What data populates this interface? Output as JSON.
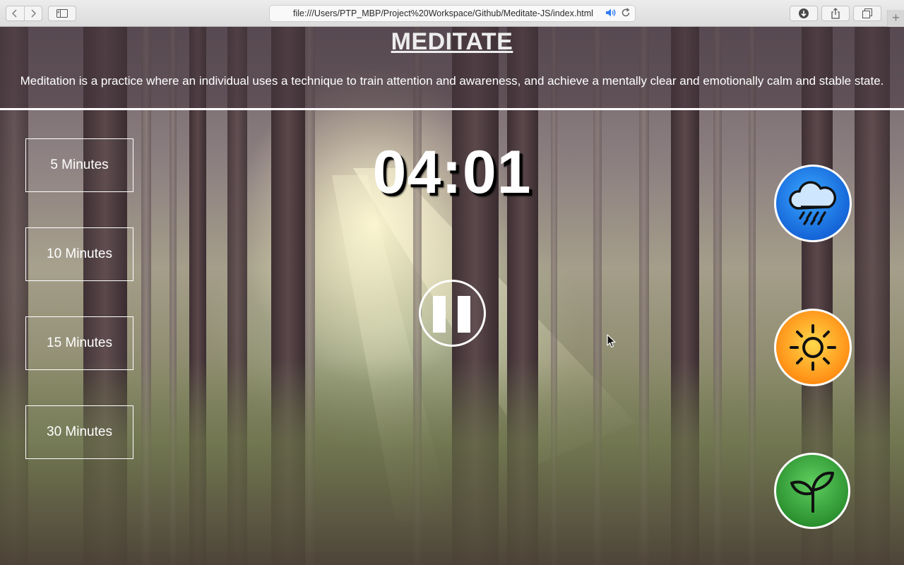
{
  "browser": {
    "url": "file:///Users/PTP_MBP/Project%20Workspace/Github/Meditate-JS/index.html",
    "new_tab_label": "+"
  },
  "header": {
    "title": "MEDITATE",
    "description": "Meditation is a practice where an individual uses a technique to train attention and awareness, and achieve a mentally clear and emotionally calm and stable state."
  },
  "durations": [
    {
      "label": "5 Minutes"
    },
    {
      "label": "10 Minutes"
    },
    {
      "label": "15 Minutes"
    },
    {
      "label": "30 Minutes"
    }
  ],
  "timer": {
    "display": "04:01",
    "state": "playing",
    "control_icon": "pause-icon"
  },
  "sounds": [
    {
      "name": "rain",
      "icon": "cloud-rain-icon",
      "color": "#1f7fe8"
    },
    {
      "name": "sun",
      "icon": "sun-icon",
      "color": "#ff9a1a"
    },
    {
      "name": "nature",
      "icon": "sprout-icon",
      "color": "#3aa83c"
    }
  ],
  "colors": {
    "text": "#ffffff",
    "header_overlay": "#46373e",
    "divider": "#ffffff"
  }
}
